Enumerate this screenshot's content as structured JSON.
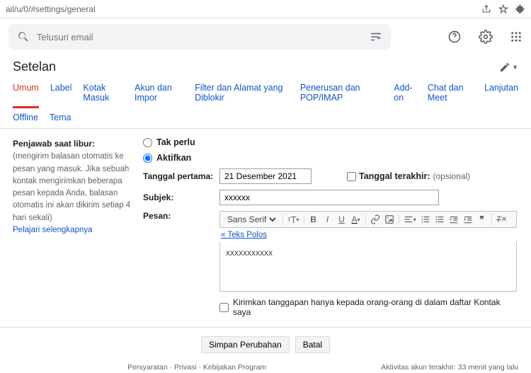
{
  "url": "ail/u/0/#settings/general",
  "search": {
    "placeholder": "Telusuri email"
  },
  "page_title": "Setelan",
  "tabs_row1": [
    "Umum",
    "Label",
    "Kotak Masuk",
    "Akun dan Impor",
    "Filter dan Alamat yang Diblokir",
    "Penerusan dan POP/IMAP",
    "Add-on",
    "Chat dan Meet",
    "Lanjutan"
  ],
  "tabs_row2": [
    "Offline",
    "Tema"
  ],
  "active_tab": "Umum",
  "vacation": {
    "section_title": "Penjawab saat libur:",
    "section_desc": "(mengirim balasan otomatis ke pesan yang masuk. Jika sebuah kontak mengirimkan beberapa pesan kepada Anda, balasan otomatis ini akan dikirim setiap 4 hari sekali)",
    "learn_more": "Pelajari selengkapnya",
    "radio_off": "Tak perlu",
    "radio_on": "Aktifkan",
    "radio_value": "on",
    "first_date_label": "Tanggal pertama:",
    "first_date_value": "21 Desember 2021",
    "last_date_label": "Tanggal terakhir:",
    "last_date_placeholder": "(opsional)",
    "subject_label": "Subjek:",
    "subject_value": "xxxxxx",
    "message_label": "Pesan:",
    "font_family": "Sans Serif",
    "plain_text_link": "« Teks Polos",
    "body_value": "xxxxxxxxxxx",
    "contacts_only_label": "Kirimkan tanggapan hanya kepada orang-orang di dalam daftar Kontak saya",
    "contacts_only_checked": false
  },
  "buttons": {
    "save": "Simpan Perubahan",
    "cancel": "Batal"
  },
  "footer": {
    "links": "Persyaratan · Privasi · Kebijakan Program",
    "activity": "Aktivitas akun terakhir: 33 menit yang lalu"
  }
}
